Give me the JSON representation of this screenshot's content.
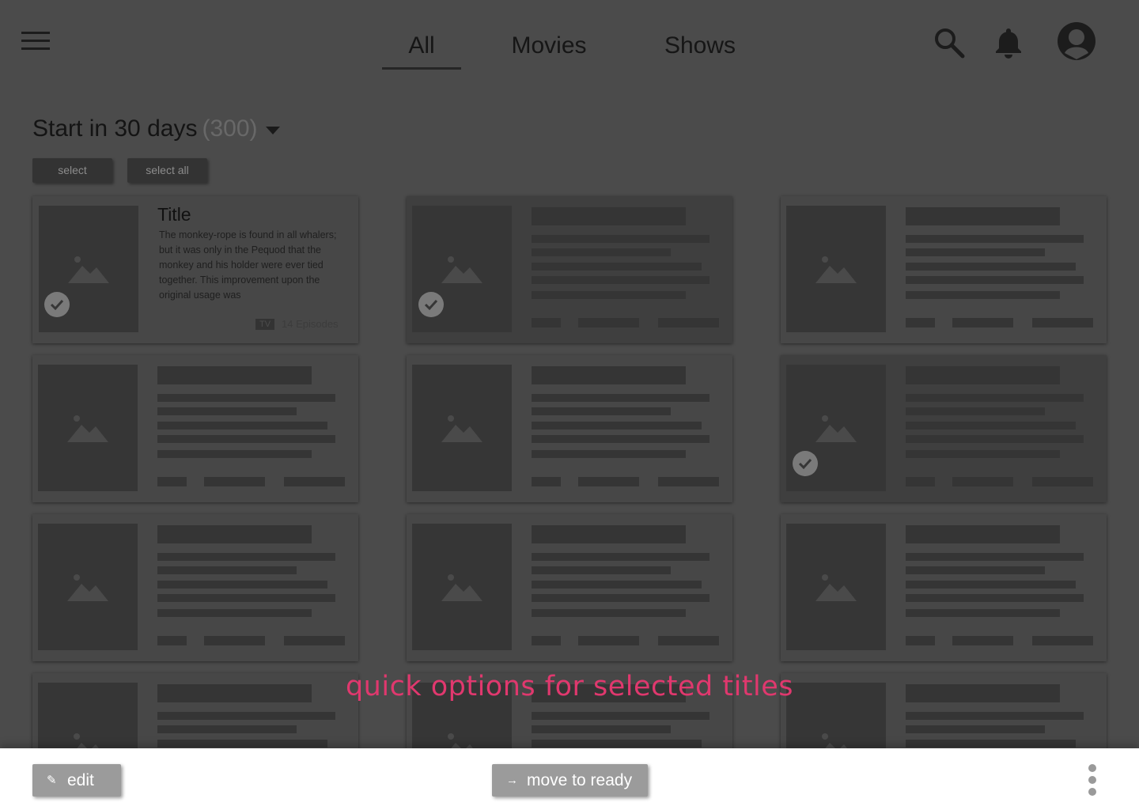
{
  "header": {
    "tabs": [
      {
        "label": "All",
        "active": true
      },
      {
        "label": "Movies",
        "active": false
      },
      {
        "label": "Shows",
        "active": false
      }
    ],
    "icons": [
      "menu-icon",
      "search-icon",
      "bell-icon",
      "avatar-icon"
    ]
  },
  "section": {
    "title": "Start in 30 days",
    "count": "(300)",
    "select_label": "select",
    "select_all_label": "select all"
  },
  "featured_card": {
    "title": "Title",
    "description": "The monkey-rope is found in all whalers; but it was only in the Pequod that the monkey and his holder were ever tied together. This improvement upon the original usage was",
    "badge": "TV",
    "episodes": "14 Episodes",
    "selected": true
  },
  "cards": [
    {
      "selected": true
    },
    {
      "selected": true
    },
    {
      "selected": false
    },
    {
      "selected": false
    },
    {
      "selected": false
    },
    {
      "selected": true
    },
    {
      "selected": false
    },
    {
      "selected": false
    },
    {
      "selected": false
    },
    {
      "selected": false
    },
    {
      "selected": false
    },
    {
      "selected": false
    }
  ],
  "annotation": "quick options for selected titles",
  "bottom_bar": {
    "edit_label": "edit",
    "move_label": "move to ready",
    "more_icon": "more-vertical-icon"
  },
  "colors": {
    "annotation": "#e0386e",
    "overlay": "#4b4b4b"
  }
}
